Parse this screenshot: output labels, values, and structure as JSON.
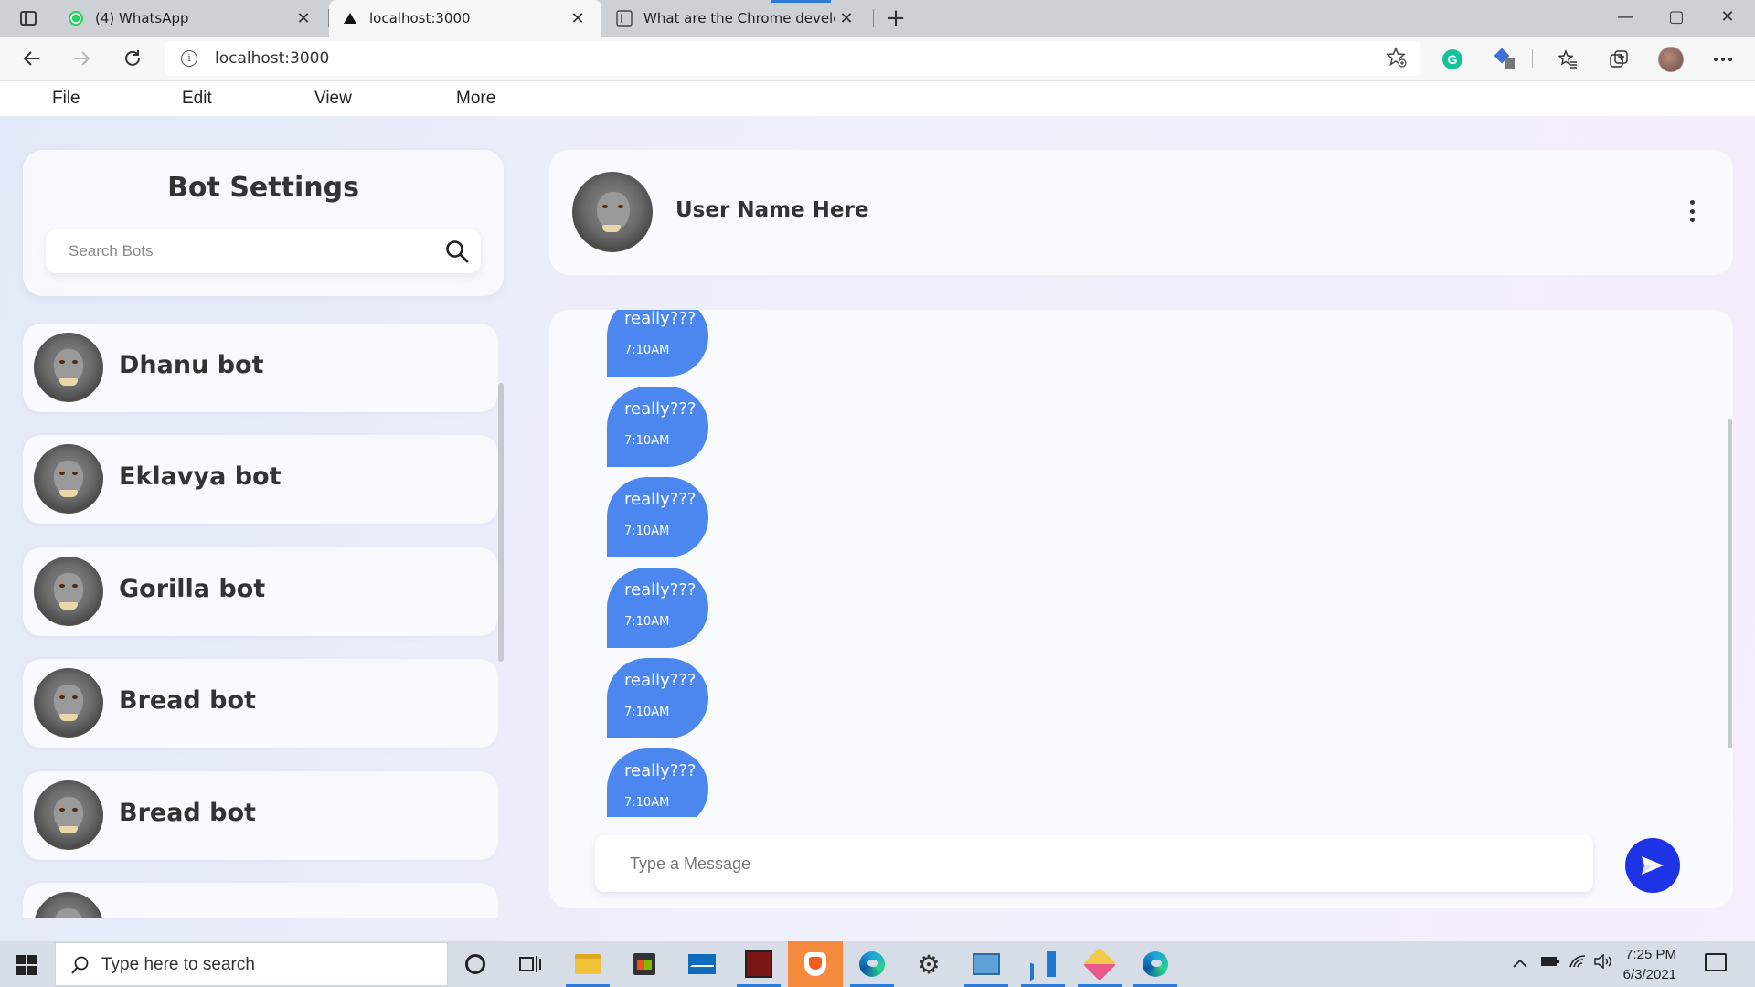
{
  "browser": {
    "tabs": [
      {
        "title": "(4) WhatsApp",
        "close": "✕",
        "favicon": "whatsapp-icon"
      },
      {
        "title": "localhost:3000",
        "close": "✕",
        "favicon": "triangle-icon"
      },
      {
        "title": "What are the Chrome developer",
        "close": "✕",
        "favicon": "devtools-icon"
      }
    ],
    "new_tab": "+",
    "window": {
      "minimize": "—",
      "maximize": "▢",
      "close": "✕"
    },
    "url": "localhost:3000",
    "toolbar_icons": [
      "back-icon",
      "forward-icon",
      "refresh-icon",
      "info-icon",
      "add-favorite-icon",
      "grammarly-icon",
      "extension-icon",
      "favorites-icon",
      "collections-icon",
      "profile-icon",
      "more-icon"
    ]
  },
  "menu": {
    "items": [
      "File",
      "Edit",
      "View",
      "More"
    ]
  },
  "sidebar": {
    "title": "Bot Settings",
    "search_placeholder": "Search Bots",
    "bots": [
      {
        "name": "Dhanu bot"
      },
      {
        "name": "Eklavya bot"
      },
      {
        "name": "Gorilla bot"
      },
      {
        "name": "Bread bot"
      },
      {
        "name": "Bread bot"
      },
      {
        "name": ""
      }
    ]
  },
  "chat": {
    "user_name": "User Name Here",
    "messages": [
      {
        "text": "really???",
        "time": "7:10AM"
      },
      {
        "text": "really???",
        "time": "7:10AM"
      },
      {
        "text": "really???",
        "time": "7:10AM"
      },
      {
        "text": "really???",
        "time": "7:10AM"
      },
      {
        "text": "really???",
        "time": "7:10AM"
      },
      {
        "text": "really???",
        "time": "7:10AM"
      }
    ],
    "composer_placeholder": "Type a Message",
    "accent_color": "#4c87f0",
    "send_color": "#1e32e6"
  },
  "taskbar": {
    "search_text": "Type here to search",
    "time": "7:25 PM",
    "date": "6/3/2021"
  }
}
